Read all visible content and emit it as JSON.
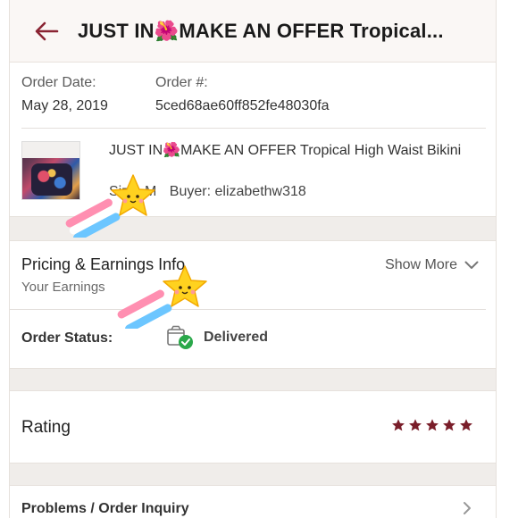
{
  "header": {
    "title": "JUST IN🌺MAKE AN OFFER Tropical..."
  },
  "order": {
    "date_label": "Order Date:",
    "date_value": "May 28, 2019",
    "number_label": "Order #:",
    "number_value": "5ced68ae60ff852fe48030fa"
  },
  "product": {
    "title": "JUST IN🌺MAKE AN OFFER Tropical High Waist Bikini",
    "size": "Size: M",
    "buyer": "Buyer: elizabethw318"
  },
  "pricing": {
    "title": "Pricing & Earnings Info",
    "subtitle": "Your Earnings",
    "show_more": "Show More"
  },
  "status": {
    "label": "Order Status:",
    "value": "Delivered"
  },
  "rating": {
    "label": "Rating",
    "stars": 5,
    "color": "#7a1e2a"
  },
  "problems": {
    "label": "Problems / Order Inquiry"
  },
  "colors": {
    "accent": "#8a2433",
    "delivered_check": "#2aa84a"
  }
}
